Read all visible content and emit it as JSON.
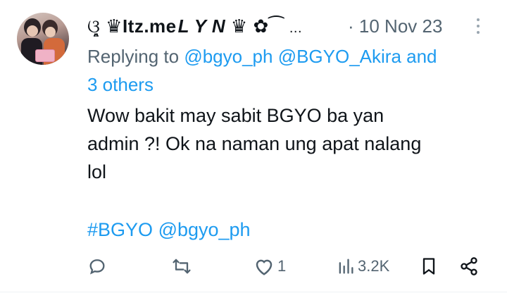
{
  "tweet": {
    "display_name": "࿌̯͙̲♎♛Иtz.meʟ ʏ ɴ ♛ ఺❀ ...",
    "display_name_text": "Itz.me",
    "display_name_bold": "L Y N",
    "name_ellipsis": "...",
    "timestamp": "10 Nov 23",
    "time_sep": "·",
    "replying_prefix": "Replying to",
    "replying_users": "@bgyo_ph @BGYO_Akira and",
    "replying_more": "3 others",
    "body_line1": "Wow bakit may sabit BGYO ba yan",
    "body_line2": "admin ?! Ok na naman ung apat nalang",
    "body_line3": "lol",
    "hashtag": "#BGYO",
    "mention": "@bgyo_ph"
  },
  "actions": {
    "replies": "",
    "retweets": "",
    "likes": "1",
    "views": "3.2K"
  },
  "icons": {
    "reply": "reply-icon",
    "retweet": "retweet-icon",
    "like": "heart-icon",
    "views": "views-icon",
    "bookmark": "bookmark-icon",
    "share": "share-icon",
    "more": "more-vertical-icon"
  },
  "colors": {
    "link": "#1d9bf0",
    "muted": "#536471",
    "text": "#0f1419"
  }
}
